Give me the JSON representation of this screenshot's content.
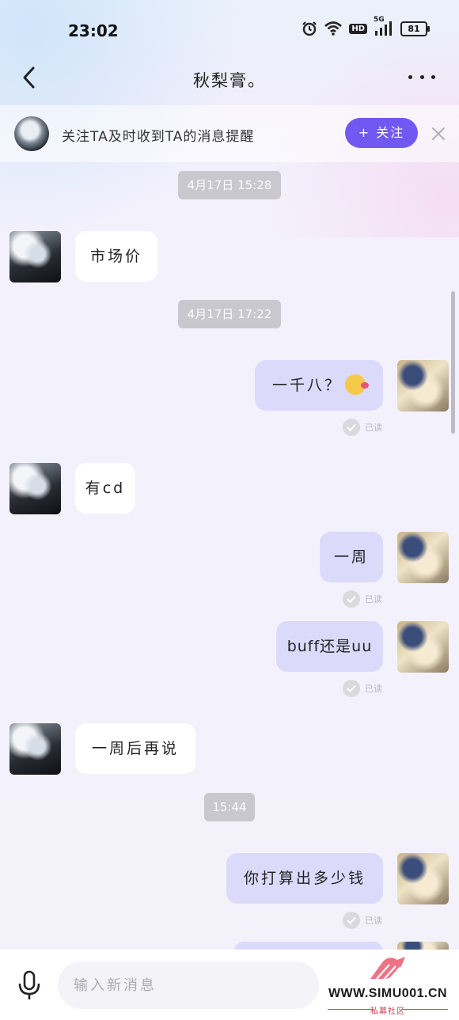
{
  "status_bar": {
    "time": "23:02",
    "network": "5G",
    "hd": "HD",
    "battery": "81"
  },
  "header": {
    "title": "秋梨膏。",
    "back_icon": "chevron-left-icon",
    "more_icon": "more-horizontal-icon"
  },
  "follow_bar": {
    "text": "关注TA及时收到TA的消息提醒",
    "button_label": "+ 关注",
    "close_icon": "close-icon"
  },
  "messages": [
    {
      "type": "timestamp",
      "text": "4月17日 15:28"
    },
    {
      "type": "message",
      "from": "other",
      "text": "市场价"
    },
    {
      "type": "timestamp",
      "text": "4月17日 17:22"
    },
    {
      "type": "message",
      "from": "self",
      "text": "一千八？",
      "emoji": "thinking-face-emoji",
      "status": "已读"
    },
    {
      "type": "message",
      "from": "other",
      "text": "有cd"
    },
    {
      "type": "message",
      "from": "self",
      "text": "一周",
      "status": "已读"
    },
    {
      "type": "message",
      "from": "self",
      "text": "buff还是uu",
      "status": "已读"
    },
    {
      "type": "message",
      "from": "other",
      "text": "一周后再说"
    },
    {
      "type": "timestamp",
      "text": "15:44"
    },
    {
      "type": "message",
      "from": "self",
      "text": "你打算出多少钱",
      "status": "已读"
    }
  ],
  "input_bar": {
    "placeholder": "输入新消息",
    "mic_icon": "microphone-icon"
  },
  "watermark": {
    "url": "WWW.SIMU001.CN",
    "subtitle": "私募社区"
  },
  "colors": {
    "accent": "#7158f2",
    "self_bubble": "#dcdafa",
    "other_bubble": "#ffffff",
    "timestamp_bg": "#c9c8ce"
  }
}
